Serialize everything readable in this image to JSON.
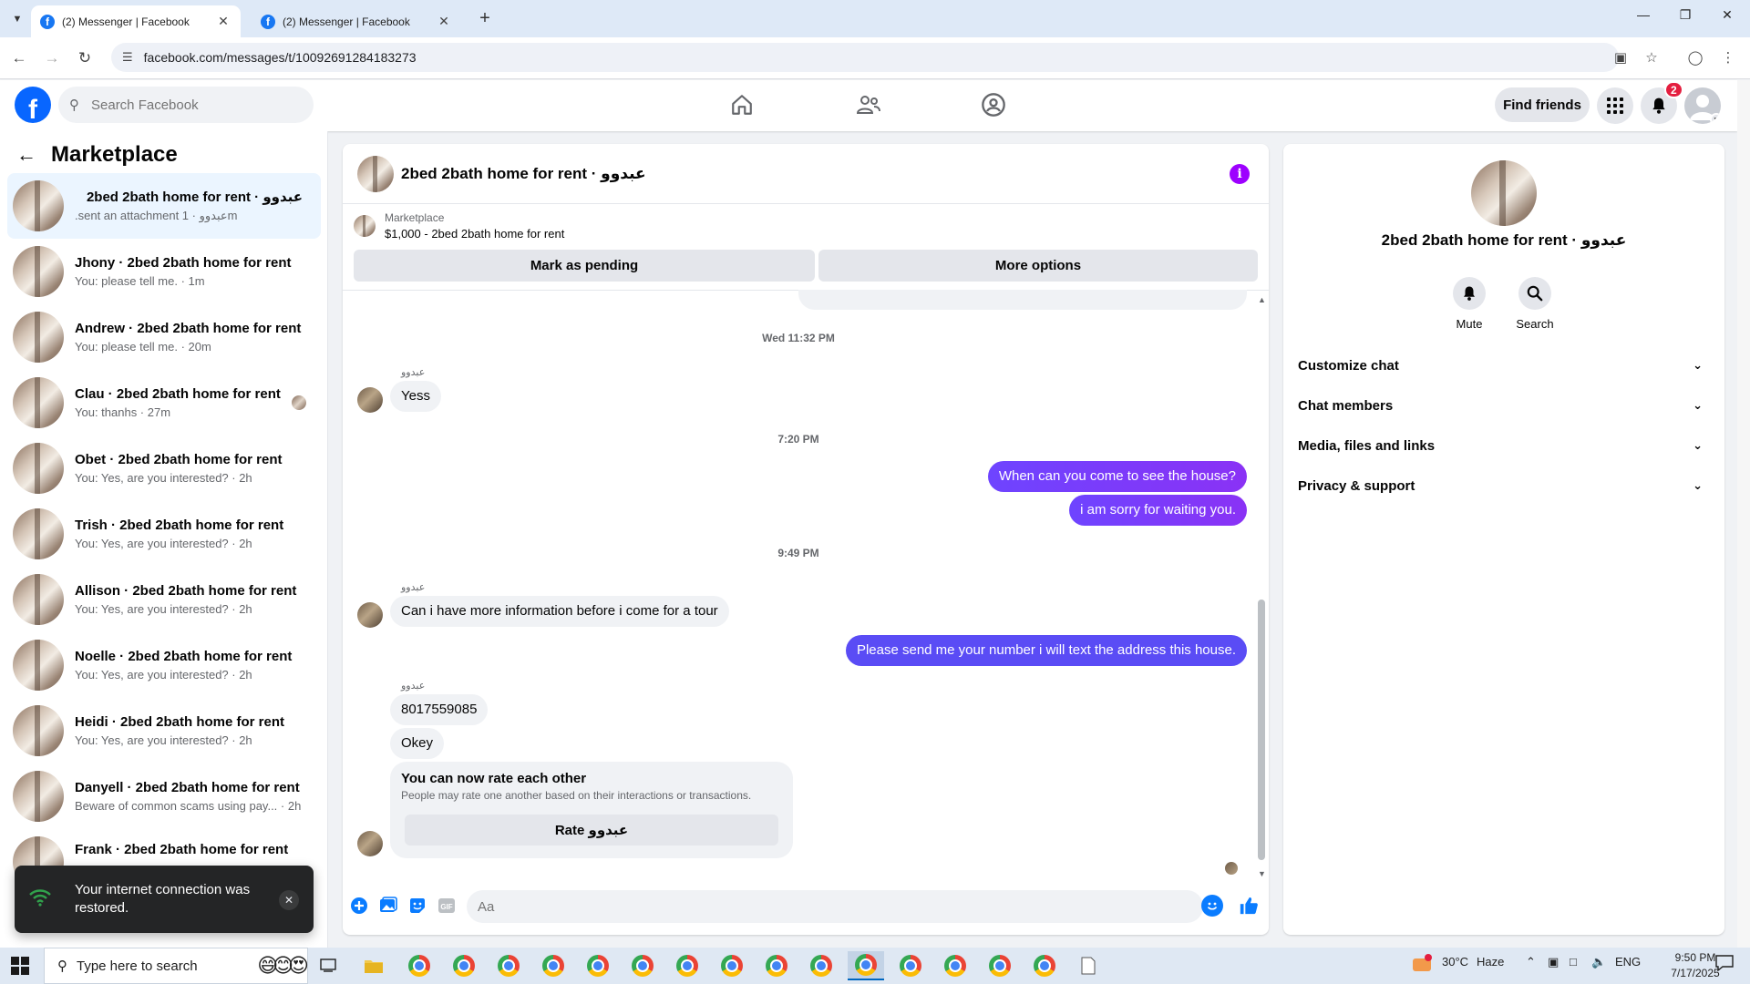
{
  "browser": {
    "tabs": [
      {
        "title": "(2) Messenger | Facebook",
        "active": true
      },
      {
        "title": "(2) Messenger | Facebook",
        "active": false
      }
    ],
    "url": "facebook.com/messages/t/10092691284183273"
  },
  "fb": {
    "search_placeholder": "Search Facebook",
    "find_friends": "Find friends",
    "notification_count": "2"
  },
  "sidebar": {
    "title": "Marketplace",
    "conversations": [
      {
        "name": "2bed 2bath home for rent · عبدوو",
        "sub": ".sent an attachment عبدوو · 1m",
        "selected": true
      },
      {
        "name": "Jhony · 2bed 2bath home for rent",
        "sub": "You: please tell me. · 1m"
      },
      {
        "name": "Andrew · 2bed 2bath home for rent",
        "sub": "You: please tell me. · 20m"
      },
      {
        "name": "Clau · 2bed 2bath home for rent",
        "sub": "You: thanhs · 27m"
      },
      {
        "name": "Obet · 2bed 2bath home for rent",
        "sub": "You: Yes, are you interested? · 2h"
      },
      {
        "name": "Trish · 2bed 2bath home for rent",
        "sub": "You: Yes, are you interested? · 2h"
      },
      {
        "name": "Allison · 2bed 2bath home for rent",
        "sub": "You: Yes, are you interested? · 2h"
      },
      {
        "name": "Noelle · 2bed 2bath home for rent",
        "sub": "You: Yes, are you interested? · 2h"
      },
      {
        "name": "Heidi · 2bed 2bath home for rent",
        "sub": "You: Yes, are you interested? · 2h"
      },
      {
        "name": "Danyell · 2bed 2bath home for rent",
        "sub": "Beware of common scams using pay... · 2h"
      },
      {
        "name": "Frank · 2bed 2bath home for rent",
        "sub": ""
      }
    ],
    "toast": "Your internet connection was restored."
  },
  "chat": {
    "title": "2bed 2bath home for rent · عبدوو",
    "listing_label": "Marketplace",
    "listing": "$1,000 - 2bed 2bath home for rent",
    "mark_pending": "Mark as pending",
    "more_options": "More options",
    "sender_name": "عبدوو",
    "ts1": "Wed 11:32 PM",
    "msg_yess": "Yess",
    "ts2": "7:20 PM",
    "out1": "When can you come to see the house?",
    "out2": "i am sorry for waiting you.",
    "ts3": "9:49 PM",
    "in2": "Can i have more information before i come for a tour",
    "out3": "Please send me your number i will text the address this house.",
    "in3": "8017559085",
    "in4": "Okey",
    "rate_title": "You can now rate each other",
    "rate_desc": "People may rate one another based on their interactions or transactions.",
    "rate_btn": "Rate عبدوو",
    "composer_placeholder": "Aa"
  },
  "info": {
    "name": "2bed 2bath home for rent · عبدوو",
    "mute": "Mute",
    "search": "Search",
    "rows": [
      "Customize chat",
      "Chat members",
      "Media, files and links",
      "Privacy & support"
    ]
  },
  "taskbar": {
    "search_placeholder": "Type here to search",
    "weather_temp": "30°C",
    "weather_desc": "Haze",
    "lang": "ENG",
    "time": "9:50 PM",
    "date": "7/17/2025"
  },
  "colors": {
    "fb_blue": "#0866ff",
    "messenger_purple": "#7b3bff",
    "selected_bg": "#ebf5ff"
  }
}
